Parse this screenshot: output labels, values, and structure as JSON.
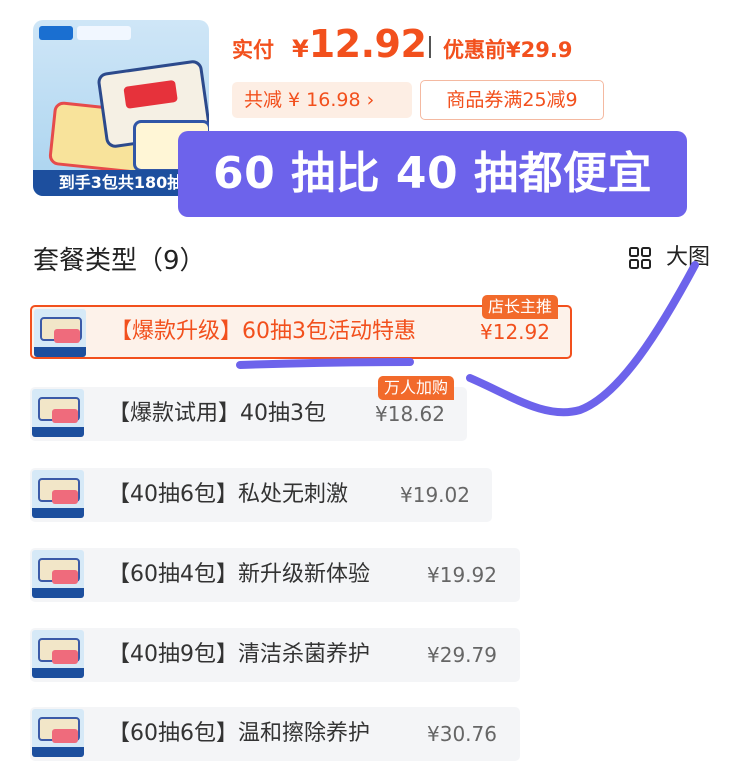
{
  "product": {
    "thumb_caption": "到手3包共180抽"
  },
  "price": {
    "actual_label": "实付",
    "currency": "¥",
    "actual_value": "12.92",
    "before_label": "优惠前",
    "before_value": "¥29.9"
  },
  "discount": {
    "total_label": "共减 ¥ 16.98 ›",
    "coupon_label": "商品券满25减9"
  },
  "overlay": {
    "text": "60 抽比 40 抽都便宜"
  },
  "package": {
    "section_title": "套餐类型（9）",
    "view_large_label": "大图"
  },
  "skus": [
    {
      "label": "【爆款升级】60抽3包活动特惠",
      "price": "¥12.92",
      "selected": true,
      "badge": "店长主推"
    },
    {
      "label": "【爆款试用】40抽3包",
      "price": "¥18.62",
      "selected": false,
      "badge": "万人加购"
    },
    {
      "label": "【40抽6包】私处无刺激",
      "price": "¥19.02",
      "selected": false
    },
    {
      "label": "【60抽4包】新升级新体验",
      "price": "¥19.92",
      "selected": false
    },
    {
      "label": "【40抽9包】清洁杀菌养护",
      "price": "¥29.79",
      "selected": false
    },
    {
      "label": "【60抽6包】温和擦除养护",
      "price": "¥30.76",
      "selected": false
    }
  ],
  "colors": {
    "accent": "#f2501d",
    "overlay": "#6d63eb",
    "chip_bg": "#fdeee4",
    "row_bg": "#f4f5f7"
  },
  "icons": {
    "view_large": "grid-icon"
  }
}
